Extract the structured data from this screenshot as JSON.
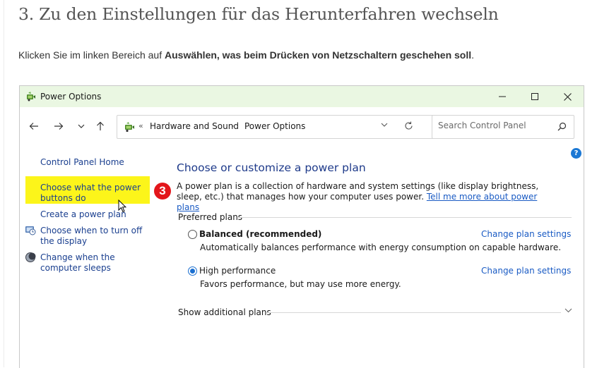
{
  "article": {
    "title": "3. Zu den Einstellungen für das Herunterfahren wechseln",
    "instruction_prefix": "Klicken Sie im linken Bereich auf ",
    "instruction_bold": "Auswählen, was beim Drücken von Netzschaltern geschehen soll",
    "instruction_suffix": "."
  },
  "window": {
    "title": "Power Options",
    "controls": {
      "minimize": "minimize-icon",
      "maximize": "maximize-icon",
      "close": "close-icon"
    }
  },
  "navbar": {
    "breadcrumb_prefix": "«",
    "breadcrumb": [
      "Hardware and Sound",
      "Power Options"
    ],
    "breadcrumb_separator": "›",
    "search_placeholder": "Search Control Panel"
  },
  "sidebar": {
    "home": "Control Panel Home",
    "items": [
      {
        "label": "Choose what the power buttons do",
        "highlighted": true
      },
      {
        "label": "Create a power plan"
      },
      {
        "label": "Choose when to turn off the display",
        "icon": "display-clock-icon"
      },
      {
        "label": "Change when the computer sleeps",
        "icon": "moon-icon"
      }
    ]
  },
  "main": {
    "title": "Choose or customize a power plan",
    "step_badge": "3",
    "description": "A power plan is a collection of hardware and system settings (like display brightness, sleep, etc.) that manages how your computer uses power. ",
    "description_link": "Tell me more about power plans",
    "preferred_label": "Preferred plans",
    "plans": [
      {
        "name": "Balanced (recommended)",
        "desc": "Automatically balances performance with energy consumption on capable hardware.",
        "link": "Change plan settings",
        "selected": false
      },
      {
        "name": "High performance",
        "desc": "Favors performance, but may use more energy.",
        "link": "Change plan settings",
        "selected": true
      }
    ],
    "additional_plans": "Show additional plans"
  },
  "help_label": "?",
  "colors": {
    "titlebar": "#eaf7e2",
    "highlight": "#fcf51a",
    "badge": "#e3161b",
    "link": "#1a5bc4"
  }
}
